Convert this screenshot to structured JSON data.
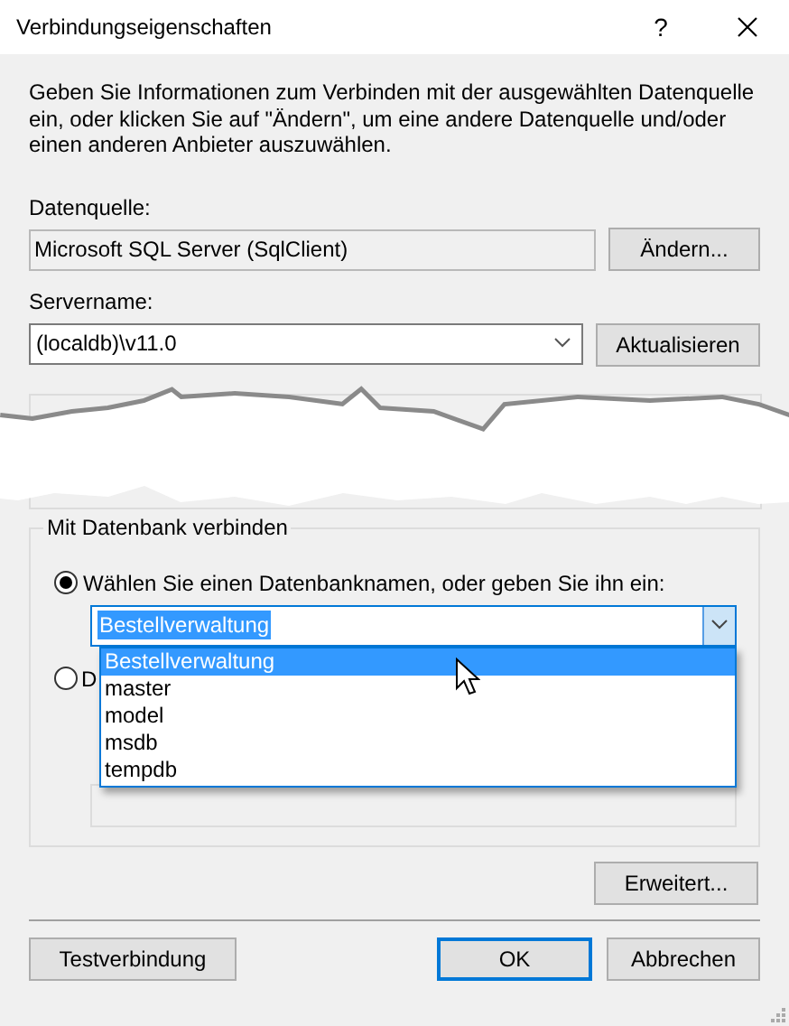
{
  "window": {
    "title": "Verbindungseigenschaften",
    "help": "?"
  },
  "description": "Geben Sie Informationen zum Verbinden mit der ausgewählten Datenquelle ein, oder klicken Sie auf \"Ändern\", um eine andere Datenquelle und/oder einen anderen Anbieter auszuwählen.",
  "data_source": {
    "label": "Datenquelle:",
    "value": "Microsoft SQL Server (SqlClient)",
    "button": "Ändern..."
  },
  "server": {
    "label": "Servername:",
    "value": "(localdb)\\v11.0",
    "button": "Aktualisieren"
  },
  "database_group": {
    "title": "Mit Datenbank verbinden",
    "options": [
      {
        "label": "Wählen Sie einen Datenbanknamen, oder geben Sie ihn ein:",
        "selected": true
      },
      {
        "label": "D",
        "selected": false
      }
    ],
    "combo": {
      "value": "Bestellverwaltung",
      "value_highlighted": true,
      "expanded": true,
      "items": [
        {
          "label": "Bestellverwaltung",
          "selected": true
        },
        {
          "label": "master",
          "selected": false
        },
        {
          "label": "model",
          "selected": false
        },
        {
          "label": "msdb",
          "selected": false
        },
        {
          "label": "tempdb",
          "selected": false
        }
      ]
    }
  },
  "advanced_button": "Erweitert...",
  "buttons": [
    {
      "label": "Testverbindung",
      "default": false
    },
    {
      "label": "OK",
      "default": true
    },
    {
      "label": "Abbrechen",
      "default": false
    }
  ]
}
